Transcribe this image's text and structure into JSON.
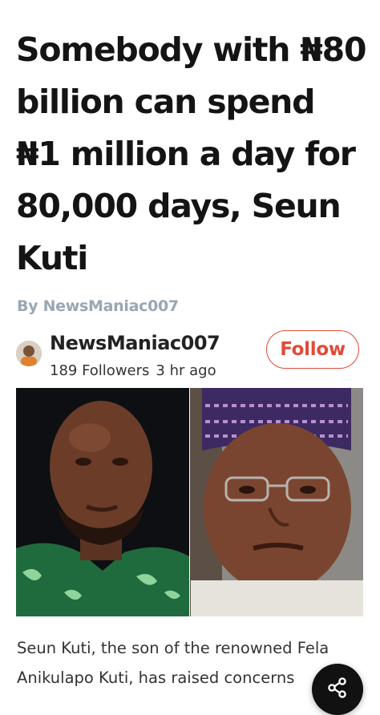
{
  "article": {
    "headline": "Somebody with ₦80 billion can spend ₦1 million a day for 80,000 days, Seun Kuti",
    "byline": "By NewsManiac007",
    "image_alt": "Seun Kuti and Yahaya Bello side by side",
    "body_preview": "Seun Kuti, the son of the renowned Fela Anikulapo Kuti, has raised concerns"
  },
  "author": {
    "name": "NewsManiac007",
    "followers": "189 Followers",
    "time_ago": "3 hr ago",
    "follow_label": "Follow"
  },
  "share_button": {
    "icon": "share-icon"
  },
  "colors": {
    "headline": "#141414",
    "byline": "#9aa6b4",
    "follow_accent": "#e04b3a",
    "body_text": "#333333",
    "share_fab": "#111111"
  }
}
